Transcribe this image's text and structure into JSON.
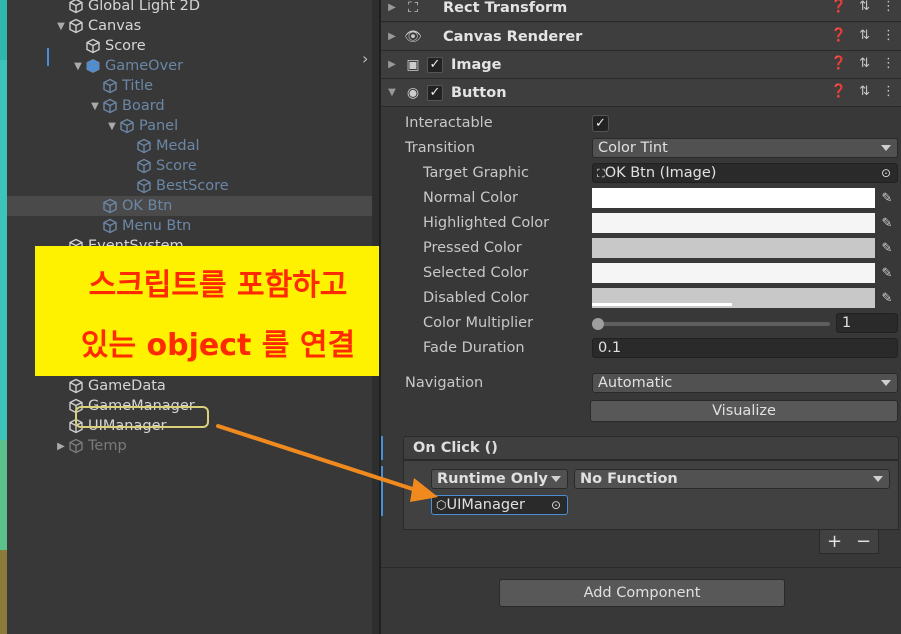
{
  "hierarchy": {
    "items": [
      {
        "label": "Global Light 2D",
        "depth": 1,
        "arrow": "",
        "style": "normal",
        "icon": "gameobject-icon"
      },
      {
        "label": "Canvas",
        "depth": 1,
        "arrow": "▼",
        "style": "normal",
        "icon": "gameobject-icon"
      },
      {
        "label": "Score",
        "depth": 2,
        "arrow": "",
        "style": "normal",
        "icon": "gameobject-icon"
      },
      {
        "label": "GameOver",
        "depth": 2,
        "arrow": "▼",
        "style": "dim",
        "icon": "prefab-icon"
      },
      {
        "label": "Title",
        "depth": 3,
        "arrow": "",
        "style": "dim",
        "icon": "gameobject-icon"
      },
      {
        "label": "Board",
        "depth": 3,
        "arrow": "▼",
        "style": "dim",
        "icon": "gameobject-icon"
      },
      {
        "label": "Panel",
        "depth": 4,
        "arrow": "▼",
        "style": "dim",
        "icon": "gameobject-icon"
      },
      {
        "label": "Medal",
        "depth": 5,
        "arrow": "",
        "style": "dim",
        "icon": "gameobject-icon"
      },
      {
        "label": "Score",
        "depth": 5,
        "arrow": "",
        "style": "dim",
        "icon": "gameobject-icon"
      },
      {
        "label": "BestScore",
        "depth": 5,
        "arrow": "",
        "style": "dim",
        "icon": "gameobject-icon"
      },
      {
        "label": "OK Btn",
        "depth": 3,
        "arrow": "",
        "style": "dim-selected",
        "icon": "gameobject-icon"
      },
      {
        "label": "Menu Btn",
        "depth": 3,
        "arrow": "",
        "style": "dim",
        "icon": "gameobject-icon"
      },
      {
        "label": "EventSystem",
        "depth": 1,
        "arrow": "",
        "style": "normal",
        "icon": "gameobject-icon"
      },
      {
        "label": "GameData",
        "depth": 1,
        "arrow": "",
        "style": "normal",
        "icon": "gameobject-icon"
      },
      {
        "label": "GameManager",
        "depth": 1,
        "arrow": "",
        "style": "normal",
        "icon": "gameobject-icon"
      },
      {
        "label": "UIManager",
        "depth": 1,
        "arrow": "",
        "style": "normal",
        "icon": "gameobject-icon"
      },
      {
        "label": "Temp",
        "depth": 1,
        "arrow": "▶",
        "style": "grey",
        "icon": "gameobject-icon"
      }
    ]
  },
  "callout": {
    "line1": "스크립트를 포함하고",
    "line2": "있는 object 를 연결"
  },
  "inspector": {
    "components": {
      "rect_transform": "Rect Transform",
      "canvas_renderer": "Canvas Renderer",
      "image": "Image",
      "button": "Button"
    },
    "button": {
      "interactable_label": "Interactable",
      "interactable_checked": true,
      "transition_label": "Transition",
      "transition_value": "Color Tint",
      "target_graphic_label": "Target Graphic",
      "target_graphic_value": "OK Btn (Image)",
      "normal_color_label": "Normal Color",
      "highlighted_color_label": "Highlighted Color",
      "pressed_color_label": "Pressed Color",
      "selected_color_label": "Selected Color",
      "disabled_color_label": "Disabled Color",
      "colors": {
        "normal": "#ffffff",
        "highlighted": "#f5f5f5",
        "pressed": "#c8c8c8",
        "selected": "#f5f5f5",
        "disabled": "#c8c8c8"
      },
      "color_multiplier_label": "Color Multiplier",
      "color_multiplier_value": "1",
      "fade_duration_label": "Fade Duration",
      "fade_duration_value": "0.1",
      "navigation_label": "Navigation",
      "navigation_value": "Automatic",
      "visualize_label": "Visualize"
    },
    "on_click": {
      "header": "On Click ()",
      "runtime_value": "Runtime Only",
      "function_value": "No Function",
      "object_value": "UIManager",
      "plus": "+",
      "minus": "−"
    },
    "add_component_label": "Add Component"
  }
}
